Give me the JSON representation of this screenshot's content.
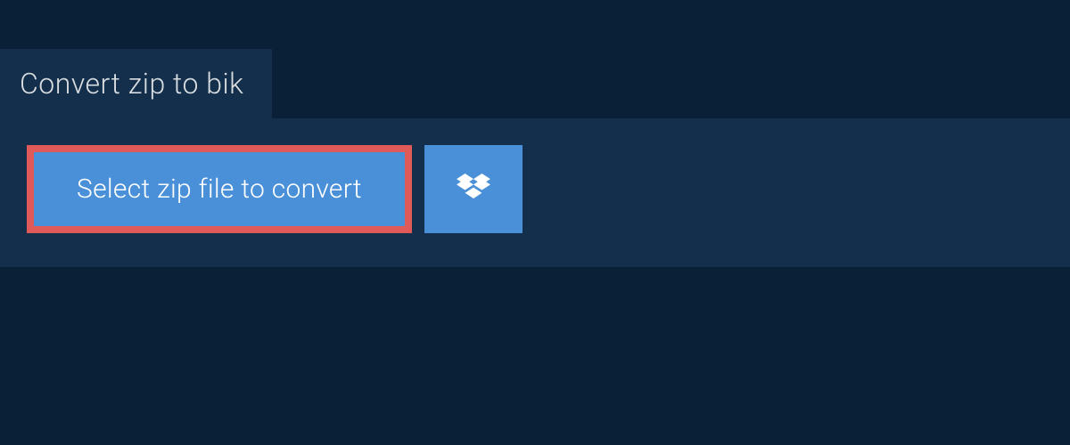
{
  "tab": {
    "title": "Convert zip to bik"
  },
  "actions": {
    "select_file_label": "Select zip file to convert",
    "dropbox_icon": "dropbox-icon"
  },
  "colors": {
    "background": "#0a2036",
    "panel": "#132f4c",
    "button": "#4a90d9",
    "highlight_border": "#e05a5a",
    "text_light": "#d9dde0",
    "text_white": "#ffffff"
  }
}
